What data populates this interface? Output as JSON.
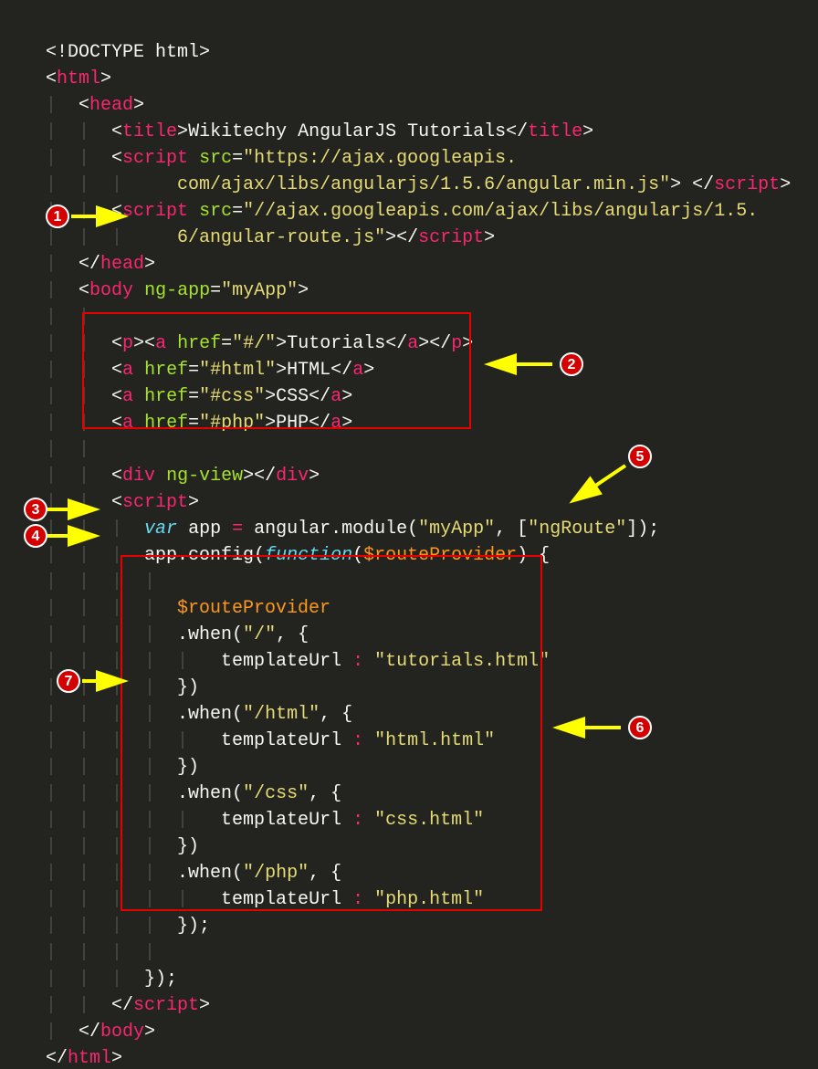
{
  "code": {
    "doctype": "<!DOCTYPE html>",
    "title_text": "Wikitechy AngularJS Tutorials",
    "script1_src": "https://ajax.googleapis.",
    "script1_src_cont": "com/ajax/libs/angularjs/1.5.6/angular.min.js",
    "script2_src": "//ajax.googleapis.com/ajax/libs/angularjs/1.5.",
    "script2_src_cont": "6/angular-route.js",
    "ng_app_attr": "ng-app",
    "ng_app_val": "myApp",
    "a1_href": "#/",
    "a1_text": "Tutorials",
    "a2_href": "#html",
    "a2_text": "HTML",
    "a3_href": "#css",
    "a3_text": "CSS",
    "a4_href": "#php",
    "a4_text": "PHP",
    "ng_view_attr": "ng-view",
    "var_kw": "var",
    "app_var": "app",
    "module_str1": "myApp",
    "module_str2": "ngRoute",
    "function_kw": "function",
    "route_provider": "$routeProvider",
    "r1_path": "/",
    "r1_tpl": "tutorials.html",
    "r2_path": "/html",
    "r2_tpl": "html.html",
    "r3_path": "/css",
    "r3_tpl": "css.html",
    "r4_path": "/php",
    "r4_tpl": "php.html",
    "templateUrl": "templateUrl"
  },
  "badges": {
    "b1": "1",
    "b2": "2",
    "b3": "3",
    "b4": "4",
    "b5": "5",
    "b6": "6",
    "b7": "7"
  }
}
